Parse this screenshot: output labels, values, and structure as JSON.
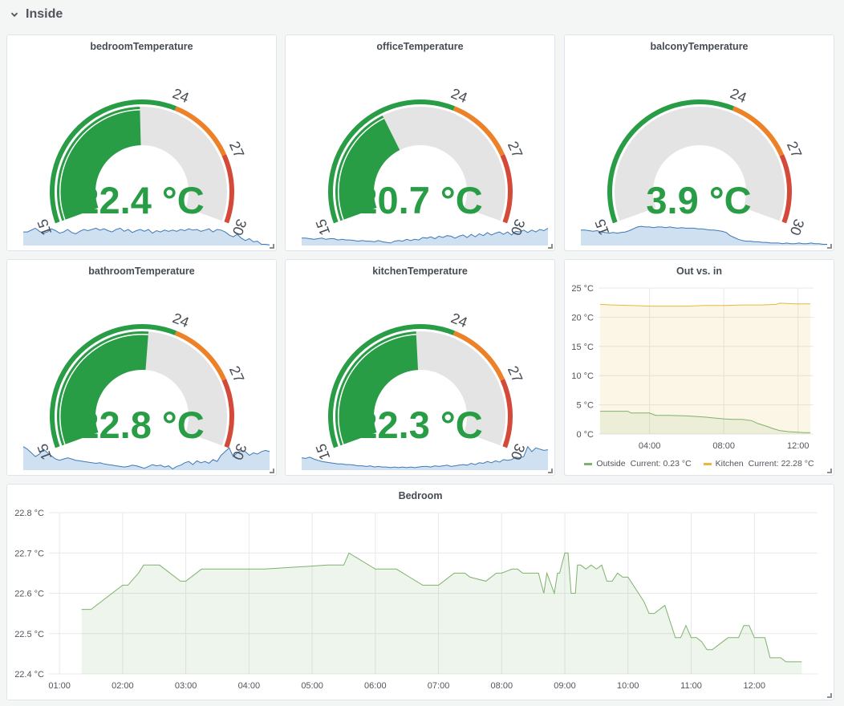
{
  "row": {
    "title": "Inside",
    "icon": "chevron-down-icon"
  },
  "colors": {
    "green": "#299c46",
    "orange": "#ed8128",
    "red": "#d44a3a",
    "track": "#e4e4e4",
    "spark_fill": "#cfe0f1",
    "spark_line": "#3f79b6",
    "outside": "#7eb26d",
    "kitchen": "#eab839"
  },
  "gauges": [
    {
      "title": "bedroomTemperature",
      "value": 22.4,
      "value_text": "22.4 °C",
      "min": 15,
      "max": 30,
      "thresholds": [
        24,
        27
      ],
      "tick_labels": [
        "15",
        "24",
        "27",
        "30"
      ],
      "sparkline": [
        0.78,
        0.78,
        0.75,
        0.72,
        0.77,
        0.8,
        0.78,
        0.73,
        0.76,
        0.8,
        0.78,
        0.74,
        0.79,
        0.81,
        0.77,
        0.74,
        0.76,
        0.74,
        0.72,
        0.75,
        0.73,
        0.76,
        0.78,
        0.74,
        0.72,
        0.77,
        0.74,
        0.79,
        0.76,
        0.74,
        0.77,
        0.74,
        0.8,
        0.76,
        0.78,
        0.75,
        0.77,
        0.75,
        0.77,
        0.74,
        0.76,
        0.73,
        0.75,
        0.74,
        0.77,
        0.75,
        0.73,
        0.78,
        0.74,
        0.75,
        0.78,
        0.83,
        0.86,
        0.82,
        0.88,
        0.92,
        0.89,
        0.94,
        0.93,
        0.98,
        0.98,
        0.99
      ]
    },
    {
      "title": "officeTemperature",
      "value": 20.7,
      "value_text": "20.7 °C",
      "min": 15,
      "max": 30,
      "thresholds": [
        24,
        27
      ],
      "tick_labels": [
        "15",
        "24",
        "27",
        "30"
      ],
      "sparkline": [
        0.88,
        0.88,
        0.89,
        0.9,
        0.89,
        0.88,
        0.9,
        0.89,
        0.89,
        0.91,
        0.9,
        0.91,
        0.91,
        0.92,
        0.93,
        0.92,
        0.93,
        0.93,
        0.94,
        0.92,
        0.94,
        0.95,
        0.96,
        0.93,
        0.92,
        0.93,
        0.9,
        0.92,
        0.9,
        0.91,
        0.87,
        0.88,
        0.86,
        0.89,
        0.85,
        0.87,
        0.84,
        0.85,
        0.88,
        0.85,
        0.83,
        0.87,
        0.82,
        0.86,
        0.81,
        0.84,
        0.79,
        0.83,
        0.8,
        0.78,
        0.82,
        0.78,
        0.83,
        0.77,
        0.78,
        0.75,
        0.79,
        0.75,
        0.78,
        0.74,
        0.76,
        0.72
      ]
    },
    {
      "title": "balconyTemperature",
      "value": 3.9,
      "value_text": "3.9 °C",
      "min": 15,
      "max": 30,
      "thresholds": [
        24,
        27
      ],
      "tick_labels": [
        "15",
        "24",
        "27",
        "30"
      ],
      "sparkline": [
        0.75,
        0.75,
        0.76,
        0.77,
        0.76,
        0.78,
        0.79,
        0.8,
        0.79,
        0.8,
        0.79,
        0.78,
        0.76,
        0.73,
        0.7,
        0.69,
        0.7,
        0.7,
        0.71,
        0.7,
        0.7,
        0.71,
        0.7,
        0.71,
        0.72,
        0.71,
        0.72,
        0.72,
        0.72,
        0.73,
        0.73,
        0.74,
        0.75,
        0.75,
        0.76,
        0.77,
        0.79,
        0.84,
        0.87,
        0.9,
        0.92,
        0.93,
        0.93,
        0.94,
        0.94,
        0.95,
        0.95,
        0.96,
        0.96,
        0.96,
        0.97,
        0.96,
        0.97,
        0.97,
        0.96,
        0.97,
        0.97,
        0.96,
        0.97,
        0.97,
        0.98,
        0.98
      ]
    },
    {
      "title": "bathroomTemperature",
      "value": 22.8,
      "value_text": "22.8 °C",
      "min": 15,
      "max": 30,
      "thresholds": [
        24,
        27
      ],
      "tick_labels": [
        "15",
        "24",
        "27",
        "30"
      ],
      "sparkline": [
        0.62,
        0.66,
        0.72,
        0.78,
        0.74,
        0.66,
        0.72,
        0.77,
        0.82,
        0.84,
        0.82,
        0.8,
        0.82,
        0.84,
        0.85,
        0.86,
        0.87,
        0.88,
        0.89,
        0.88,
        0.9,
        0.91,
        0.92,
        0.93,
        0.94,
        0.95,
        0.94,
        0.92,
        0.93,
        0.95,
        0.97,
        0.94,
        0.91,
        0.93,
        0.92,
        0.95,
        0.93,
        0.98,
        0.94,
        0.92,
        0.88,
        0.86,
        0.91,
        0.85,
        0.88,
        0.86,
        0.89,
        0.83,
        0.86,
        0.76,
        0.7,
        0.64,
        0.78,
        0.72,
        0.68,
        0.7,
        0.76,
        0.72,
        0.74,
        0.7,
        0.68,
        0.7
      ]
    },
    {
      "title": "kitchenTemperature",
      "value": 22.3,
      "value_text": "22.3 °C",
      "min": 15,
      "max": 30,
      "thresholds": [
        24,
        27
      ],
      "tick_labels": [
        "15",
        "24",
        "27",
        "30"
      ],
      "sparkline": [
        0.8,
        0.81,
        0.79,
        0.82,
        0.84,
        0.86,
        0.87,
        0.88,
        0.89,
        0.9,
        0.9,
        0.91,
        0.91,
        0.92,
        0.93,
        0.93,
        0.94,
        0.93,
        0.95,
        0.94,
        0.95,
        0.95,
        0.96,
        0.95,
        0.96,
        0.95,
        0.96,
        0.95,
        0.96,
        0.95,
        0.94,
        0.94,
        0.95,
        0.93,
        0.94,
        0.93,
        0.92,
        0.94,
        0.93,
        0.92,
        0.91,
        0.92,
        0.89,
        0.91,
        0.88,
        0.89,
        0.86,
        0.88,
        0.85,
        0.87,
        0.83,
        0.84,
        0.83,
        0.79,
        0.8,
        0.78,
        0.62,
        0.7,
        0.64,
        0.66,
        0.68,
        0.67
      ]
    }
  ],
  "outvsin": {
    "title": "Out vs. in",
    "legend": [
      {
        "name": "Outside",
        "current_label": "Current:",
        "current": "0.23 °C"
      },
      {
        "name": "Kitchen",
        "current_label": "Current:",
        "current": "22.28 °C"
      }
    ]
  },
  "bedroom": {
    "title": "Bedroom"
  },
  "chart_data": [
    {
      "type": "area",
      "title": "Out vs. in",
      "ylim": [
        0,
        25
      ],
      "yticks": [
        0,
        5,
        10,
        15,
        20,
        25
      ],
      "ytick_labels": [
        "0 °C",
        "5 °C",
        "10 °C",
        "15 °C",
        "20 °C",
        "25 °C"
      ],
      "xlim": [
        "01:15",
        "12:50"
      ],
      "xticks": [
        "04:00",
        "08:00",
        "12:00"
      ],
      "grid": true,
      "legend_position": "bottom",
      "series": [
        {
          "name": "Outside",
          "color": "#7eb26d",
          "x": [
            "01:20",
            "02:50",
            "03:00",
            "04:00",
            "04:20",
            "05:00",
            "06:00",
            "07:00",
            "08:00",
            "08:30",
            "09:00",
            "09:30",
            "09:50",
            "10:20",
            "10:40",
            "11:00",
            "11:30",
            "12:00",
            "12:20",
            "12:40"
          ],
          "values": [
            3.9,
            3.9,
            3.6,
            3.6,
            3.2,
            3.2,
            3.1,
            2.9,
            2.6,
            2.5,
            2.5,
            2.3,
            1.8,
            1.3,
            0.9,
            0.6,
            0.4,
            0.3,
            0.25,
            0.23
          ]
        },
        {
          "name": "Kitchen",
          "color": "#eab839",
          "x": [
            "01:20",
            "02:00",
            "03:00",
            "04:00",
            "05:00",
            "06:00",
            "07:00",
            "08:00",
            "09:00",
            "10:00",
            "10:50",
            "11:00",
            "11:50",
            "12:00",
            "12:40"
          ],
          "values": [
            22.2,
            22.1,
            22.0,
            21.9,
            21.9,
            21.9,
            22.0,
            22.0,
            22.1,
            22.1,
            22.2,
            22.4,
            22.3,
            22.3,
            22.28
          ]
        }
      ]
    },
    {
      "type": "area",
      "title": "Bedroom",
      "ylim": [
        22.4,
        22.8
      ],
      "yticks": [
        22.4,
        22.5,
        22.6,
        22.7,
        22.8
      ],
      "ytick_labels": [
        "22.4 °C",
        "22.5 °C",
        "22.6 °C",
        "22.7 °C",
        "22.8 °C"
      ],
      "xlim": [
        "00:50",
        "13:00"
      ],
      "xticks": [
        "01:00",
        "02:00",
        "03:00",
        "04:00",
        "05:00",
        "06:00",
        "07:00",
        "08:00",
        "09:00",
        "10:00",
        "11:00",
        "12:00"
      ],
      "grid": true,
      "series": [
        {
          "name": "",
          "color": "#7eb26d",
          "x": [
            "01:21",
            "01:30",
            "02:00",
            "02:05",
            "02:15",
            "02:20",
            "02:35",
            "02:55",
            "03:00",
            "03:15",
            "04:15",
            "05:15",
            "05:30",
            "05:35",
            "06:00",
            "06:20",
            "06:45",
            "07:00",
            "07:15",
            "07:25",
            "07:30",
            "07:45",
            "07:55",
            "08:00",
            "08:10",
            "08:15",
            "08:20",
            "08:35",
            "08:40",
            "08:43",
            "08:50",
            "08:53",
            "08:55",
            "09:00",
            "09:03",
            "09:06",
            "09:10",
            "09:12",
            "09:15",
            "09:20",
            "09:25",
            "09:30",
            "09:35",
            "09:40",
            "09:45",
            "09:50",
            "09:55",
            "10:00",
            "10:05",
            "10:10",
            "10:15",
            "10:20",
            "10:25",
            "10:35",
            "10:45",
            "10:50",
            "10:55",
            "11:00",
            "11:05",
            "11:10",
            "11:15",
            "11:20",
            "11:25",
            "11:30",
            "11:35",
            "11:45",
            "11:50",
            "11:55",
            "12:00",
            "12:10",
            "12:15",
            "12:25",
            "12:30",
            "12:35",
            "12:40",
            "12:45"
          ],
          "values": [
            22.56,
            22.56,
            22.62,
            22.62,
            22.65,
            22.67,
            22.67,
            22.63,
            22.63,
            22.66,
            22.66,
            22.67,
            22.67,
            22.7,
            22.66,
            22.66,
            22.62,
            22.62,
            22.65,
            22.65,
            22.64,
            22.63,
            22.65,
            22.65,
            22.66,
            22.66,
            22.65,
            22.65,
            22.6,
            22.65,
            22.6,
            22.65,
            22.65,
            22.7,
            22.7,
            22.6,
            22.6,
            22.67,
            22.67,
            22.66,
            22.67,
            22.66,
            22.67,
            22.63,
            22.63,
            22.65,
            22.64,
            22.64,
            22.62,
            22.6,
            22.58,
            22.55,
            22.55,
            22.57,
            22.49,
            22.49,
            22.52,
            22.49,
            22.49,
            22.48,
            22.46,
            22.46,
            22.47,
            22.48,
            22.49,
            22.49,
            22.52,
            22.52,
            22.49,
            22.49,
            22.44,
            22.44,
            22.43,
            22.43,
            22.43,
            22.43
          ]
        }
      ]
    }
  ]
}
